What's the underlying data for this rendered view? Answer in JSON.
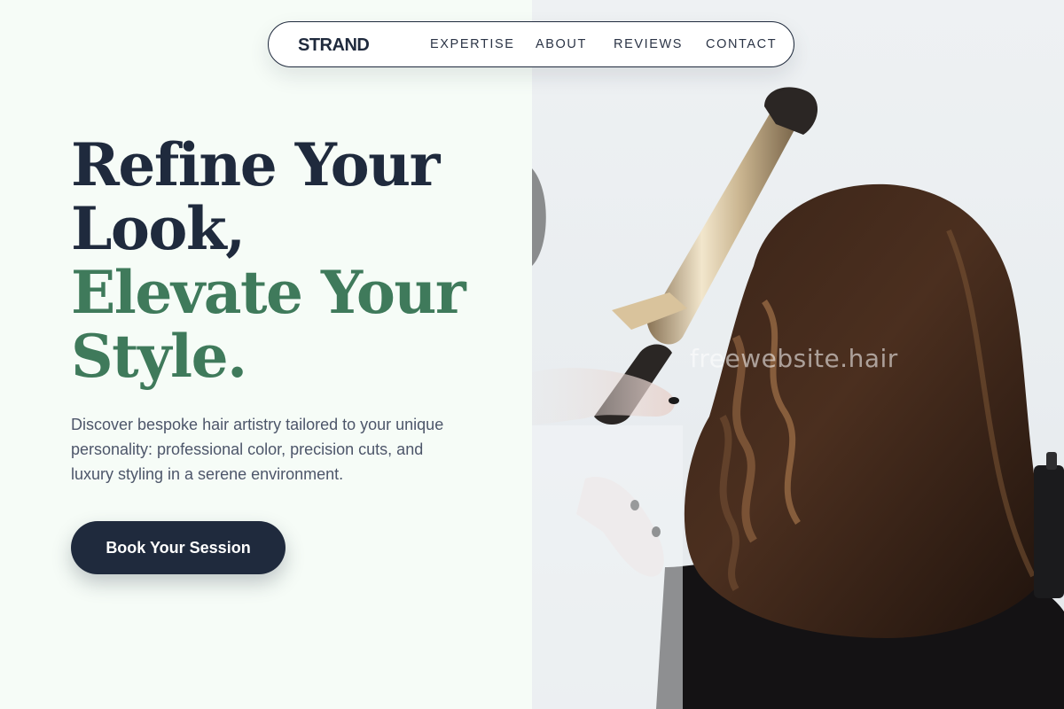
{
  "nav": {
    "brand": "STRAND",
    "links": [
      {
        "label": "EXPERTISE"
      },
      {
        "label": "ABOUT"
      },
      {
        "label": "REVIEWS"
      },
      {
        "label": "CONTACT"
      }
    ]
  },
  "hero": {
    "headline_line1": "Refine Your",
    "headline_line2": "Look,",
    "headline_line3": "Elevate Your",
    "headline_line4": "Style.",
    "description": "Discover bespoke hair artistry tailored to your unique personality: professional color, precision cuts, and luxury styling in a serene environment.",
    "cta_label": "Book Your Session"
  },
  "image": {
    "subject": "stylist curling a woman's long brown hair with a curling iron",
    "watermark": "freewebsite.hair"
  },
  "colors": {
    "navy": "#1f2a3d",
    "green": "#3f7a5b",
    "background": "#f6fcf7",
    "body_text": "#4d566a"
  }
}
